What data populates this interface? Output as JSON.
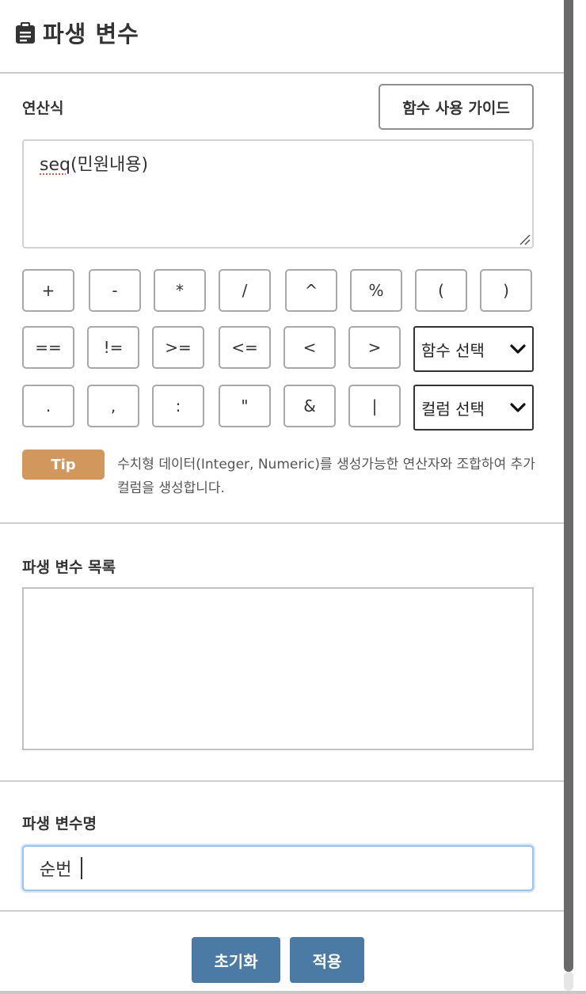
{
  "header": {
    "title": "파생 변수",
    "icon": "clipboard-icon"
  },
  "expression": {
    "label": "연산식",
    "guide_button": "함수 사용 가이드",
    "value_underlined": "seq",
    "value_rest": "(민원내용)"
  },
  "operators": {
    "row1": [
      "+",
      "-",
      "*",
      "/",
      "^",
      "%",
      "(",
      ")"
    ],
    "row2": [
      "==",
      "!=",
      ">=",
      "<=",
      "<",
      ">"
    ],
    "row3": [
      ".",
      ",",
      ":",
      "\"",
      "&",
      "|"
    ]
  },
  "selects": {
    "function": "함수 선택",
    "column": "컬럼 선택"
  },
  "tip": {
    "badge": "Tip",
    "text": "수치형 데이터(Integer, Numeric)를 생성가능한 연산자와 조합하여 추가 컬럼을 생성합니다."
  },
  "var_list": {
    "label": "파생 변수 목록"
  },
  "var_name": {
    "label": "파생 변수명",
    "value": "순번"
  },
  "footer": {
    "reset": "초기화",
    "apply": "적용"
  },
  "colors": {
    "accent": "#4b7aa5",
    "tip": "#d1975c"
  }
}
